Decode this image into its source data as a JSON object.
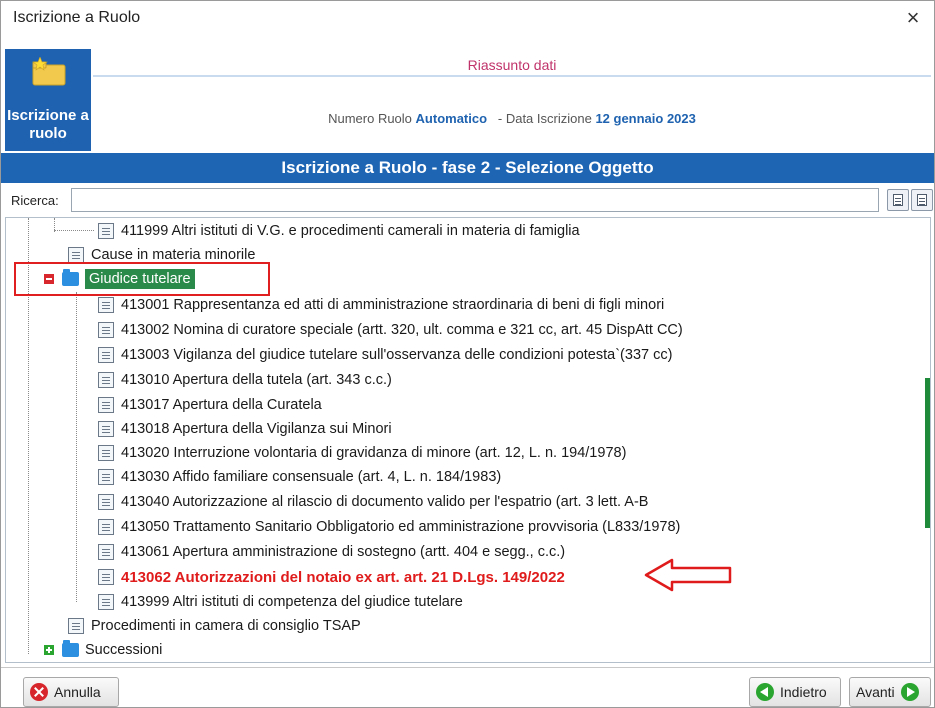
{
  "window": {
    "title": "Iscrizione a Ruolo",
    "close_glyph": "×"
  },
  "header": {
    "side_tile_label": "Iscrizione a ruolo",
    "riassunto": "Riassunto dati",
    "numero_ruolo_label": "Numero Ruolo",
    "numero_ruolo_value": "Automatico",
    "data_iscrizione_label": "- Data Iscrizione",
    "data_iscrizione_value": "12 gennaio 2023"
  },
  "phase_title": "Iscrizione a Ruolo - fase 2 - Selezione Oggetto",
  "search": {
    "label": "Ricerca:",
    "value": ""
  },
  "tree": {
    "top_item": "411999 Altri istituti di V.G. e procedimenti camerali  in materia di famiglia",
    "cause_minorile": "Cause in materia minorile",
    "giudice_tutelare": "Giudice tutelare",
    "children": [
      "413001 Rappresentanza ed atti di amministrazione straordinaria di beni di figli minori",
      "413002 Nomina di curatore speciale (artt. 320, ult. comma e 321 cc, art. 45 DispAtt CC)",
      "413003 Vigilanza del giudice tutelare sull'osservanza delle condizioni potesta`(337 cc)",
      "413010 Apertura della tutela (art. 343 c.c.)",
      "413017 Apertura della Curatela",
      "413018 Apertura della Vigilanza sui Minori",
      "413020 Interruzione volontaria di gravidanza di minore (art. 12, L. n. 194/1978)",
      "413030 Affido familiare consensuale (art. 4, L. n. 184/1983)",
      "413040 Autorizzazione al rilascio di documento valido per l'espatrio (art. 3 lett.  A-B",
      "413050 Trattamento Sanitario Obbligatorio ed amministrazione provvisoria (L833/1978)",
      "413061 Apertura amministrazione di sostegno (artt. 404 e segg., c.c.)",
      "413062 Autorizzazioni del notaio ex art. art. 21 D.Lgs. 149/2022",
      "413999 Altri istituti di competenza del giudice tutelare"
    ],
    "tsap": "Procedimenti in camera di consiglio TSAP",
    "successioni": "Successioni"
  },
  "colors": {
    "primary_blue": "#1e66b4",
    "highlight_red": "#e01b1b",
    "selected_green": "#2a8a4a"
  },
  "buttons": {
    "annulla": "Annulla",
    "indietro": "Indietro",
    "avanti": "Avanti"
  }
}
